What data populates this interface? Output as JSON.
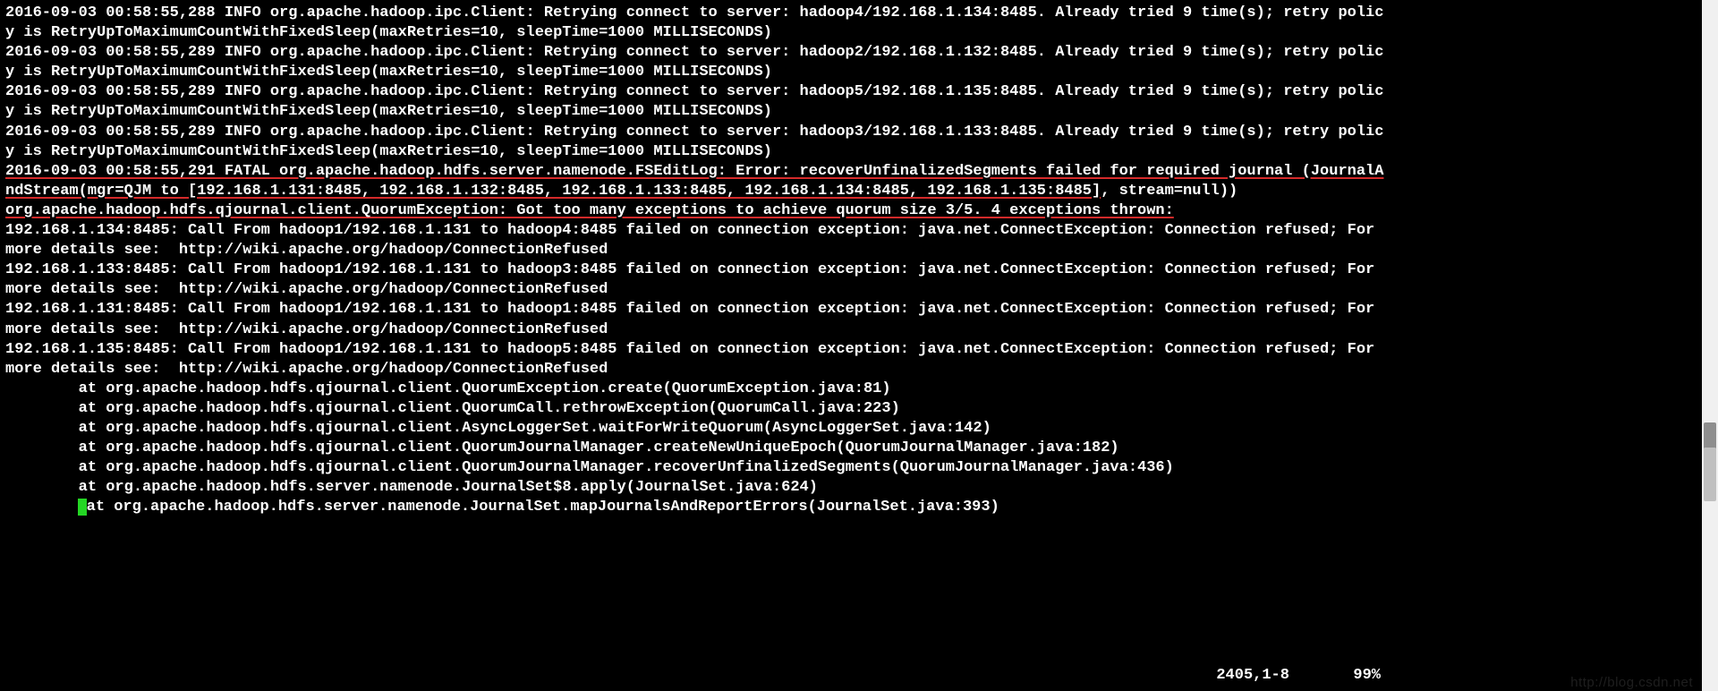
{
  "log_info": [
    "2016-09-03 00:58:55,288 INFO org.apache.hadoop.ipc.Client: Retrying connect to server: hadoop4/192.168.1.134:8485. Already tried 9 time(s); retry policy is RetryUpToMaximumCountWithFixedSleep(maxRetries=10, sleepTime=1000 MILLISECONDS)",
    "2016-09-03 00:58:55,289 INFO org.apache.hadoop.ipc.Client: Retrying connect to server: hadoop2/192.168.1.132:8485. Already tried 9 time(s); retry policy is RetryUpToMaximumCountWithFixedSleep(maxRetries=10, sleepTime=1000 MILLISECONDS)",
    "2016-09-03 00:58:55,289 INFO org.apache.hadoop.ipc.Client: Retrying connect to server: hadoop5/192.168.1.135:8485. Already tried 9 time(s); retry policy is RetryUpToMaximumCountWithFixedSleep(maxRetries=10, sleepTime=1000 MILLISECONDS)",
    "2016-09-03 00:58:55,289 INFO org.apache.hadoop.ipc.Client: Retrying connect to server: hadoop3/192.168.1.133:8485. Already tried 9 time(s); retry policy is RetryUpToMaximumCountWithFixedSleep(maxRetries=10, sleepTime=1000 MILLISECONDS)"
  ],
  "fatal": {
    "p1": "2016-09-03 00:58:55,291 FATAL org.apache.hadoop.hdfs.server.namenode.FSEditLog: Error: recoverUnfinalizedSegments failed for required journal (JournalAndStream(mgr=QJM to [192.168.1.131:8485, 192.168.1.132:8485, 192.168.1.133:8485, 192.168.1.134:8485, 192.168.1.135:8485]",
    "p2": ", stream=null))"
  },
  "quorum_exception": "org.apache.hadoop.hdfs.qjournal.client.QuorumException: Got too many exceptions to achieve quorum size 3/5. 4 exceptions thrown:",
  "connect_exceptions": [
    "192.168.1.134:8485: Call From hadoop1/192.168.1.131 to hadoop4:8485 failed on connection exception: java.net.ConnectException: Connection refused; For more details see:  http://wiki.apache.org/hadoop/ConnectionRefused",
    "192.168.1.133:8485: Call From hadoop1/192.168.1.131 to hadoop3:8485 failed on connection exception: java.net.ConnectException: Connection refused; For more details see:  http://wiki.apache.org/hadoop/ConnectionRefused",
    "192.168.1.131:8485: Call From hadoop1/192.168.1.131 to hadoop1:8485 failed on connection exception: java.net.ConnectException: Connection refused; For more details see:  http://wiki.apache.org/hadoop/ConnectionRefused",
    "192.168.1.135:8485: Call From hadoop1/192.168.1.131 to hadoop5:8485 failed on connection exception: java.net.ConnectException: Connection refused; For more details see:  http://wiki.apache.org/hadoop/ConnectionRefused"
  ],
  "stack_trace": [
    "        at org.apache.hadoop.hdfs.qjournal.client.QuorumException.create(QuorumException.java:81)",
    "        at org.apache.hadoop.hdfs.qjournal.client.QuorumCall.rethrowException(QuorumCall.java:223)",
    "        at org.apache.hadoop.hdfs.qjournal.client.AsyncLoggerSet.waitForWriteQuorum(AsyncLoggerSet.java:142)",
    "        at org.apache.hadoop.hdfs.qjournal.client.QuorumJournalManager.createNewUniqueEpoch(QuorumJournalManager.java:182)",
    "        at org.apache.hadoop.hdfs.qjournal.client.QuorumJournalManager.recoverUnfinalizedSegments(QuorumJournalManager.java:436)",
    "        at org.apache.hadoop.hdfs.server.namenode.JournalSet$8.apply(JournalSet.java:624)"
  ],
  "stack_trace_last": {
    "prefix": "        ",
    "rest": "at org.apache.hadoop.hdfs.server.namenode.JournalSet.mapJournalsAndReportErrors(JournalSet.java:393)"
  },
  "status": {
    "pos": "2405,1-8",
    "pct": "99%"
  },
  "watermark": "http://blog.csdn.net"
}
